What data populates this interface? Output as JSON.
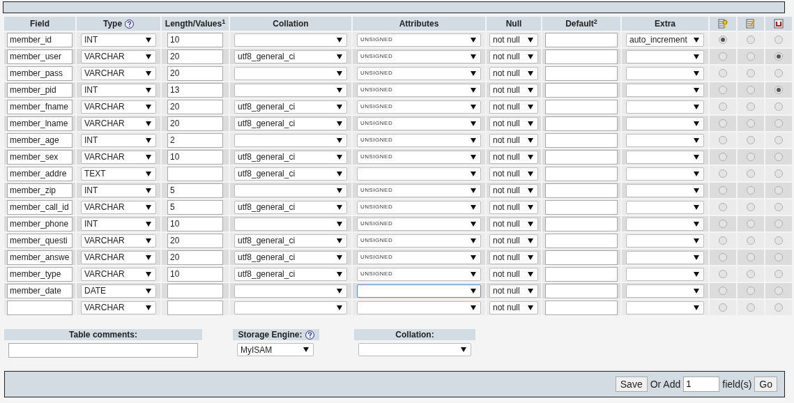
{
  "columns": [
    {
      "label": "Field",
      "help": false
    },
    {
      "label": "Type",
      "help": true
    },
    {
      "label": "Length/Values$^{1}$",
      "help": false
    },
    {
      "label": "Collation",
      "help": false
    },
    {
      "label": "Attributes",
      "help": false
    },
    {
      "label": "Null",
      "help": false
    },
    {
      "label": "Default$^{2}$",
      "help": false
    },
    {
      "label": "Extra",
      "help": false
    }
  ],
  "index_columns": [
    {
      "kind": "primary"
    },
    {
      "kind": "index"
    },
    {
      "kind": "unique"
    }
  ],
  "rows": [
    {
      "field": "member_id",
      "type": "INT",
      "length": "10",
      "collation": "",
      "attributes": "UNSIGNED",
      "attributes_focused": false,
      "null": "not null",
      "default": "",
      "extra": "auto_increment",
      "radios": [
        {
          "selected": true
        },
        {
          "selected": false
        },
        {
          "selected": false
        }
      ]
    },
    {
      "field": "member_user",
      "type": "VARCHAR",
      "length": "20",
      "collation": "utf8_general_ci",
      "attributes": "UNSIGNED",
      "attributes_focused": false,
      "null": "not null",
      "default": "",
      "extra": "",
      "radios": [
        {
          "selected": false
        },
        {
          "selected": false
        },
        {
          "selected": true
        }
      ]
    },
    {
      "field": "member_pass",
      "type": "VARCHAR",
      "length": "20",
      "collation": "",
      "attributes": "UNSIGNED",
      "attributes_focused": false,
      "null": "not null",
      "default": "",
      "extra": "",
      "radios": [
        {
          "selected": false
        },
        {
          "selected": false
        },
        {
          "selected": false
        }
      ]
    },
    {
      "field": "member_pid",
      "type": "INT",
      "length": "13",
      "collation": "",
      "attributes": "UNSIGNED",
      "attributes_focused": false,
      "null": "not null",
      "default": "",
      "extra": "",
      "radios": [
        {
          "selected": false
        },
        {
          "selected": false
        },
        {
          "selected": true
        }
      ]
    },
    {
      "field": "member_fname",
      "type": "VARCHAR",
      "length": "20",
      "collation": "utf8_general_ci",
      "attributes": "UNSIGNED",
      "attributes_focused": false,
      "null": "not null",
      "default": "",
      "extra": "",
      "radios": [
        {
          "selected": false
        },
        {
          "selected": false
        },
        {
          "selected": false
        }
      ]
    },
    {
      "field": "member_lname",
      "type": "VARCHAR",
      "length": "20",
      "collation": "utf8_general_ci",
      "attributes": "UNSIGNED",
      "attributes_focused": false,
      "null": "not null",
      "default": "",
      "extra": "",
      "radios": [
        {
          "selected": false
        },
        {
          "selected": false
        },
        {
          "selected": false
        }
      ]
    },
    {
      "field": "member_age",
      "type": "INT",
      "length": "2",
      "collation": "",
      "attributes": "UNSIGNED",
      "attributes_focused": false,
      "null": "not null",
      "default": "",
      "extra": "",
      "radios": [
        {
          "selected": false
        },
        {
          "selected": false
        },
        {
          "selected": false
        }
      ]
    },
    {
      "field": "member_sex",
      "type": "VARCHAR",
      "length": "10",
      "collation": "utf8_general_ci",
      "attributes": "UNSIGNED",
      "attributes_focused": false,
      "null": "not null",
      "default": "",
      "extra": "",
      "radios": [
        {
          "selected": false
        },
        {
          "selected": false
        },
        {
          "selected": false
        }
      ]
    },
    {
      "field": "member_addre",
      "type": "TEXT",
      "length": "",
      "collation": "utf8_general_ci",
      "attributes": "",
      "attributes_focused": false,
      "null": "not null",
      "default": "",
      "extra": "",
      "radios": [
        {
          "selected": false
        },
        {
          "selected": false
        },
        {
          "selected": false
        }
      ]
    },
    {
      "field": "member_zip",
      "type": "INT",
      "length": "5",
      "collation": "",
      "attributes": "UNSIGNED",
      "attributes_focused": false,
      "null": "not null",
      "default": "",
      "extra": "",
      "radios": [
        {
          "selected": false
        },
        {
          "selected": false
        },
        {
          "selected": false
        }
      ]
    },
    {
      "field": "member_call_id",
      "type": "VARCHAR",
      "length": "5",
      "collation": "utf8_general_ci",
      "attributes": "UNSIGNED",
      "attributes_focused": false,
      "null": "not null",
      "default": "",
      "extra": "",
      "radios": [
        {
          "selected": false
        },
        {
          "selected": false
        },
        {
          "selected": false
        }
      ]
    },
    {
      "field": "member_phone",
      "type": "INT",
      "length": "10",
      "collation": "",
      "attributes": "UNSIGNED",
      "attributes_focused": false,
      "null": "not null",
      "default": "",
      "extra": "",
      "radios": [
        {
          "selected": false
        },
        {
          "selected": false
        },
        {
          "selected": false
        }
      ]
    },
    {
      "field": "member_questi",
      "type": "VARCHAR",
      "length": "20",
      "collation": "utf8_general_ci",
      "attributes": "UNSIGNED",
      "attributes_focused": false,
      "null": "not null",
      "default": "",
      "extra": "",
      "radios": [
        {
          "selected": false
        },
        {
          "selected": false
        },
        {
          "selected": false
        }
      ]
    },
    {
      "field": "member_answe",
      "type": "VARCHAR",
      "length": "20",
      "collation": "utf8_general_ci",
      "attributes": "UNSIGNED",
      "attributes_focused": false,
      "null": "not null",
      "default": "",
      "extra": "",
      "radios": [
        {
          "selected": false
        },
        {
          "selected": false
        },
        {
          "selected": false
        }
      ]
    },
    {
      "field": "member_type",
      "type": "VARCHAR",
      "length": "10",
      "collation": "utf8_general_ci",
      "attributes": "UNSIGNED",
      "attributes_focused": false,
      "null": "not null",
      "default": "",
      "extra": "",
      "radios": [
        {
          "selected": false
        },
        {
          "selected": false
        },
        {
          "selected": false
        }
      ]
    },
    {
      "field": "member_date",
      "type": "DATE",
      "length": "",
      "collation": "",
      "attributes": "",
      "attributes_focused": true,
      "null": "not null",
      "default": "",
      "extra": "",
      "radios": [
        {
          "selected": false
        },
        {
          "selected": false
        },
        {
          "selected": false
        }
      ]
    },
    {
      "field": "",
      "type": "VARCHAR",
      "length": "",
      "collation": "",
      "attributes": "",
      "attributes_focused": false,
      "null": "not null",
      "default": "",
      "extra": "",
      "radios": [
        {
          "selected": false
        },
        {
          "selected": false
        },
        {
          "selected": false
        }
      ]
    }
  ],
  "table_options": {
    "comments_label": "Table comments:",
    "engine_label": "Storage Engine:",
    "engine_help": true,
    "engine": "MyISAM",
    "collation_label": "Collation:"
  },
  "footer": {
    "save": "Save",
    "or_add": "Or Add",
    "count": "1",
    "fields": "field(s)",
    "go": "Go"
  }
}
